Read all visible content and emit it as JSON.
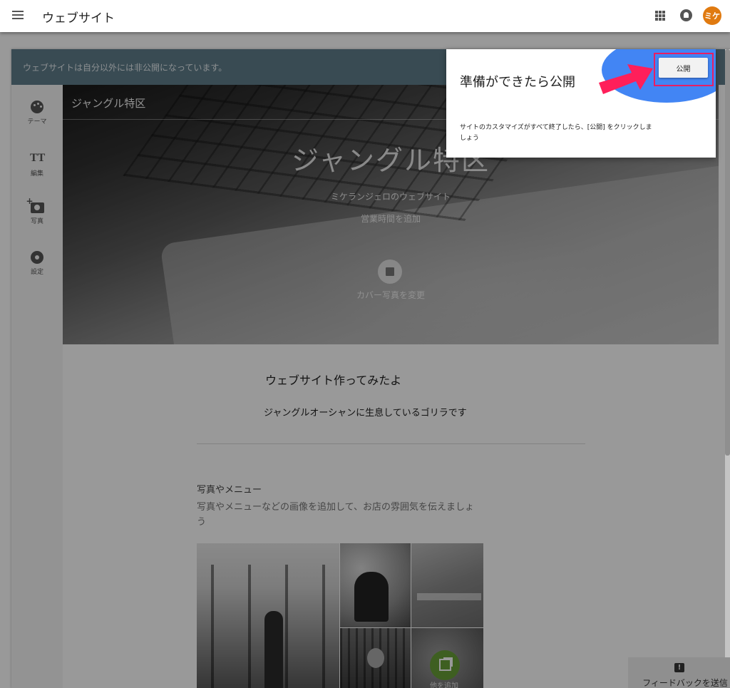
{
  "app": {
    "title": "ウェブサイト",
    "avatar_text": "ミケ"
  },
  "banner": {
    "text": "ウェブサイトは自分以外には非公開になっています。"
  },
  "sidebar": {
    "items": [
      {
        "label": "テーマ",
        "icon": "palette-icon"
      },
      {
        "label": "編集",
        "icon": "text-edit-icon"
      },
      {
        "label": "写真",
        "icon": "add-photo-icon"
      },
      {
        "label": "設定",
        "icon": "gear-icon"
      }
    ]
  },
  "hero": {
    "site_name": "ジャングル特区",
    "title": "ジャングル特区",
    "subtitle": "ミケランジェロのウェブサイト",
    "hours": "営業時間を追加",
    "cover_label": "カバー写真を変更"
  },
  "intro": {
    "heading": "ウェブサイト作ってみたよ",
    "text": "ジャングルオーシャンに生息しているゴリラです"
  },
  "gallery": {
    "heading": "写真やメニュー",
    "description": "写真やメニューなどの画像を追加して、お店の雰囲気を伝えましょう",
    "more_label": "他を追加"
  },
  "tooltip": {
    "heading": "準備ができたら公開",
    "body": "サイトのカスタマイズがすべて終了したら、[公開] をクリックしましょう",
    "publish_label": "公開"
  },
  "feedback": {
    "label": "フィードバックを送信"
  },
  "colors": {
    "banner": "#607d8b",
    "accent_blue": "#4285f4",
    "highlight_pink": "#e91e63",
    "avatar": "#e07a10",
    "add_button_green": "#689f38"
  }
}
